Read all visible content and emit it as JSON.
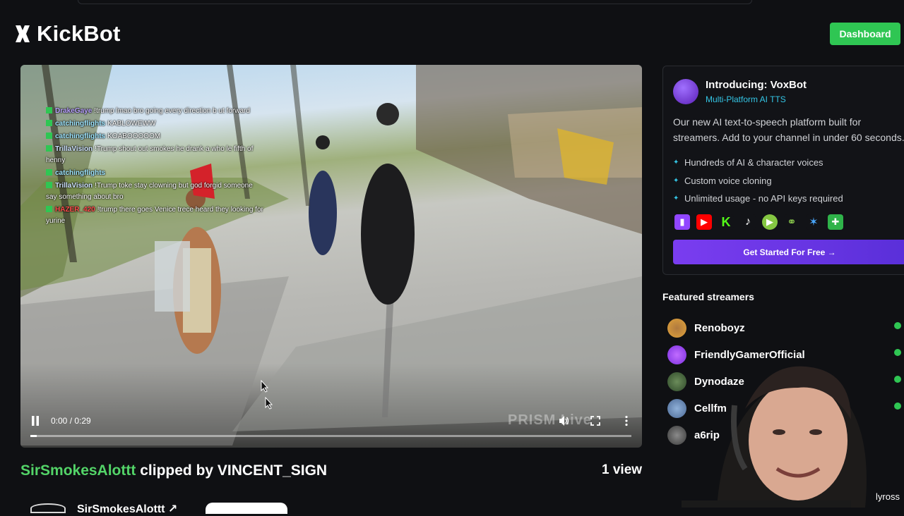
{
  "app": {
    "name": "KickBot",
    "dashboard_label": "Dashboard"
  },
  "video": {
    "chat": [
      {
        "user": "DrakeGaye",
        "color": "u-purple",
        "message": "!trump lmao bro going every direction b ut forward"
      },
      {
        "user": "catchingflights",
        "color": "u-cyan",
        "message": "KABLOWEWW"
      },
      {
        "user": "catchingflights",
        "color": "u-cyan",
        "message": "KOABOOOOOM"
      },
      {
        "user": "TrillaVision",
        "color": "u-light",
        "message": "!Trump shout out smokes he drank a who le fifth of henny"
      },
      {
        "user": "catchingflights",
        "color": "u-cyan",
        "message": ""
      },
      {
        "user": "TrillaVision",
        "color": "u-light",
        "message": "!Trump toke stay clowning but god forgid someone say something about bro"
      },
      {
        "user": "HAZER_420",
        "color": "u-red",
        "message": "!trump there goes Venice trece heard they looking for yurine"
      }
    ],
    "time": "0:00 / 0:29",
    "progress": 0.01,
    "watermark": "PRISM Live"
  },
  "clip": {
    "streamer": "SirSmokesAlottt",
    "clipped_by": "clipped by VINCENT_SIGN",
    "views": "1 view",
    "channel_name": "SirSmokesAlottt ↗"
  },
  "promo": {
    "title": "Introducing: VoxBot",
    "subtitle": "Multi-Platform AI TTS",
    "description": "Our new AI text-to-speech platform built for streamers. Add to your channel in under 60 seconds.",
    "features": [
      "Hundreds of AI & character voices",
      "Custom voice cloning",
      "Unlimited usage - no API keys required"
    ],
    "cta": "Get Started For Free →",
    "colors": {
      "accent": "#34c6e6",
      "cta": "#6a35e6"
    }
  },
  "featured": {
    "heading": "Featured streamers",
    "streamers": [
      {
        "name": "Renoboyz"
      },
      {
        "name": "FriendlyGamerOfficial"
      },
      {
        "name": "Dynodaze"
      },
      {
        "name": "Cellfm"
      },
      {
        "name": "a6rip"
      }
    ]
  },
  "webcam": {
    "label": "lyross"
  },
  "colors": {
    "brand_green": "#2fc653",
    "background": "#0f1013"
  }
}
